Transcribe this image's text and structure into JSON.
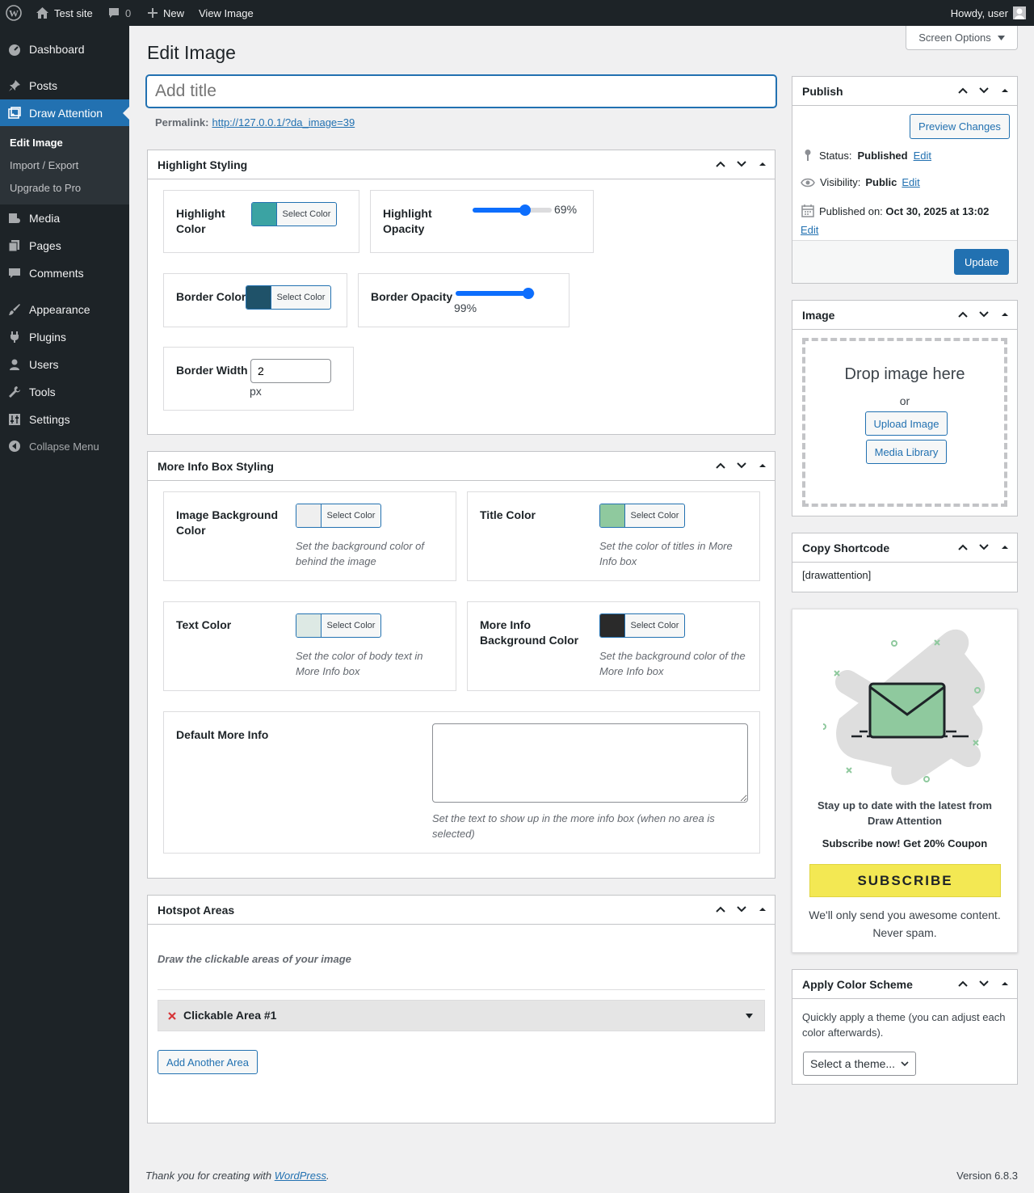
{
  "admin_bar": {
    "site_name": "Test site",
    "comments_count": "0",
    "new_label": "New",
    "view_label": "View Image",
    "howdy": "Howdy, user"
  },
  "sidebar": {
    "items": [
      {
        "label": "Dashboard",
        "icon": "dashboard-icon"
      },
      {
        "label": "Posts",
        "icon": "pin-icon"
      },
      {
        "label": "Draw Attention",
        "icon": "images-icon"
      },
      {
        "label": "Media",
        "icon": "media-icon"
      },
      {
        "label": "Pages",
        "icon": "pages-icon"
      },
      {
        "label": "Comments",
        "icon": "comments-icon"
      },
      {
        "label": "Appearance",
        "icon": "brush-icon"
      },
      {
        "label": "Plugins",
        "icon": "plugin-icon"
      },
      {
        "label": "Users",
        "icon": "users-icon"
      },
      {
        "label": "Tools",
        "icon": "wrench-icon"
      },
      {
        "label": "Settings",
        "icon": "settings-icon"
      }
    ],
    "submenu": [
      "Edit Image",
      "Import / Export",
      "Upgrade to Pro"
    ],
    "collapse": "Collapse Menu"
  },
  "screen_options": "Screen Options",
  "page_title": "Edit Image",
  "title_placeholder": "Add title",
  "permalink": {
    "label": "Permalink:",
    "url": "http://127.0.0.1/?da_image=39"
  },
  "highlight_styling": {
    "title": "Highlight Styling",
    "highlight_color": {
      "label": "Highlight Color",
      "button": "Select Color",
      "color": "#3ba3a3"
    },
    "highlight_opacity": {
      "label": "Highlight Opacity",
      "value": "69%",
      "fraction": 0.69
    },
    "border_color": {
      "label": "Border Color",
      "button": "Select Color",
      "color": "#1f5269"
    },
    "border_opacity": {
      "label": "Border Opacity",
      "value": "99%",
      "fraction": 0.99
    },
    "border_width": {
      "label": "Border Width",
      "value": "2",
      "unit": "px"
    }
  },
  "more_info": {
    "title": "More Info Box Styling",
    "image_bg": {
      "label": "Image Background Color",
      "button": "Select Color",
      "color": "#efefef",
      "desc": "Set the background color of behind the image"
    },
    "title_color": {
      "label": "Title Color",
      "button": "Select Color",
      "color": "#8fc99e",
      "desc": "Set the color of titles in More Info box"
    },
    "text_color": {
      "label": "Text Color",
      "button": "Select Color",
      "color": "#dde9e4",
      "desc": "Set the color of body text in More Info box"
    },
    "bg_color": {
      "label": "More Info Background Color",
      "button": "Select Color",
      "color": "#2a2a2a",
      "desc": "Set the background color of the More Info box"
    },
    "default": {
      "label": "Default More Info",
      "value": "",
      "desc": "Set the text to show up in the more info box (when no area is selected)"
    }
  },
  "hotspots": {
    "title": "Hotspot Areas",
    "desc": "Draw the clickable areas of your image",
    "area": "Clickable Area #1",
    "add": "Add Another Area"
  },
  "publish": {
    "title": "Publish",
    "preview": "Preview Changes",
    "status_label": "Status:",
    "status": "Published",
    "visibility_label": "Visibility:",
    "visibility": "Public",
    "edit": "Edit",
    "published_label": "Published on:",
    "published_on": "Oct 30, 2025 at 13:02",
    "update": "Update"
  },
  "image_box": {
    "title": "Image",
    "drop": "Drop image here",
    "or": "or",
    "upload": "Upload Image",
    "library": "Media Library"
  },
  "shortcode": {
    "title": "Copy Shortcode",
    "value": "[drawattention]"
  },
  "promo": {
    "line1": "Stay up to date with the latest from Draw Attention",
    "line2": "Subscribe now! Get 20% Coupon",
    "button": "SUBSCRIBE",
    "note": "We'll only send you awesome content. Never spam."
  },
  "scheme": {
    "title": "Apply Color Scheme",
    "desc": "Quickly apply a theme (you can adjust each color afterwards).",
    "select": "Select a theme..."
  },
  "footer": {
    "thanks_prefix": "Thank you for creating with ",
    "thanks_link": "WordPress",
    "thanks_suffix": ".",
    "version": "Version 6.8.3"
  }
}
